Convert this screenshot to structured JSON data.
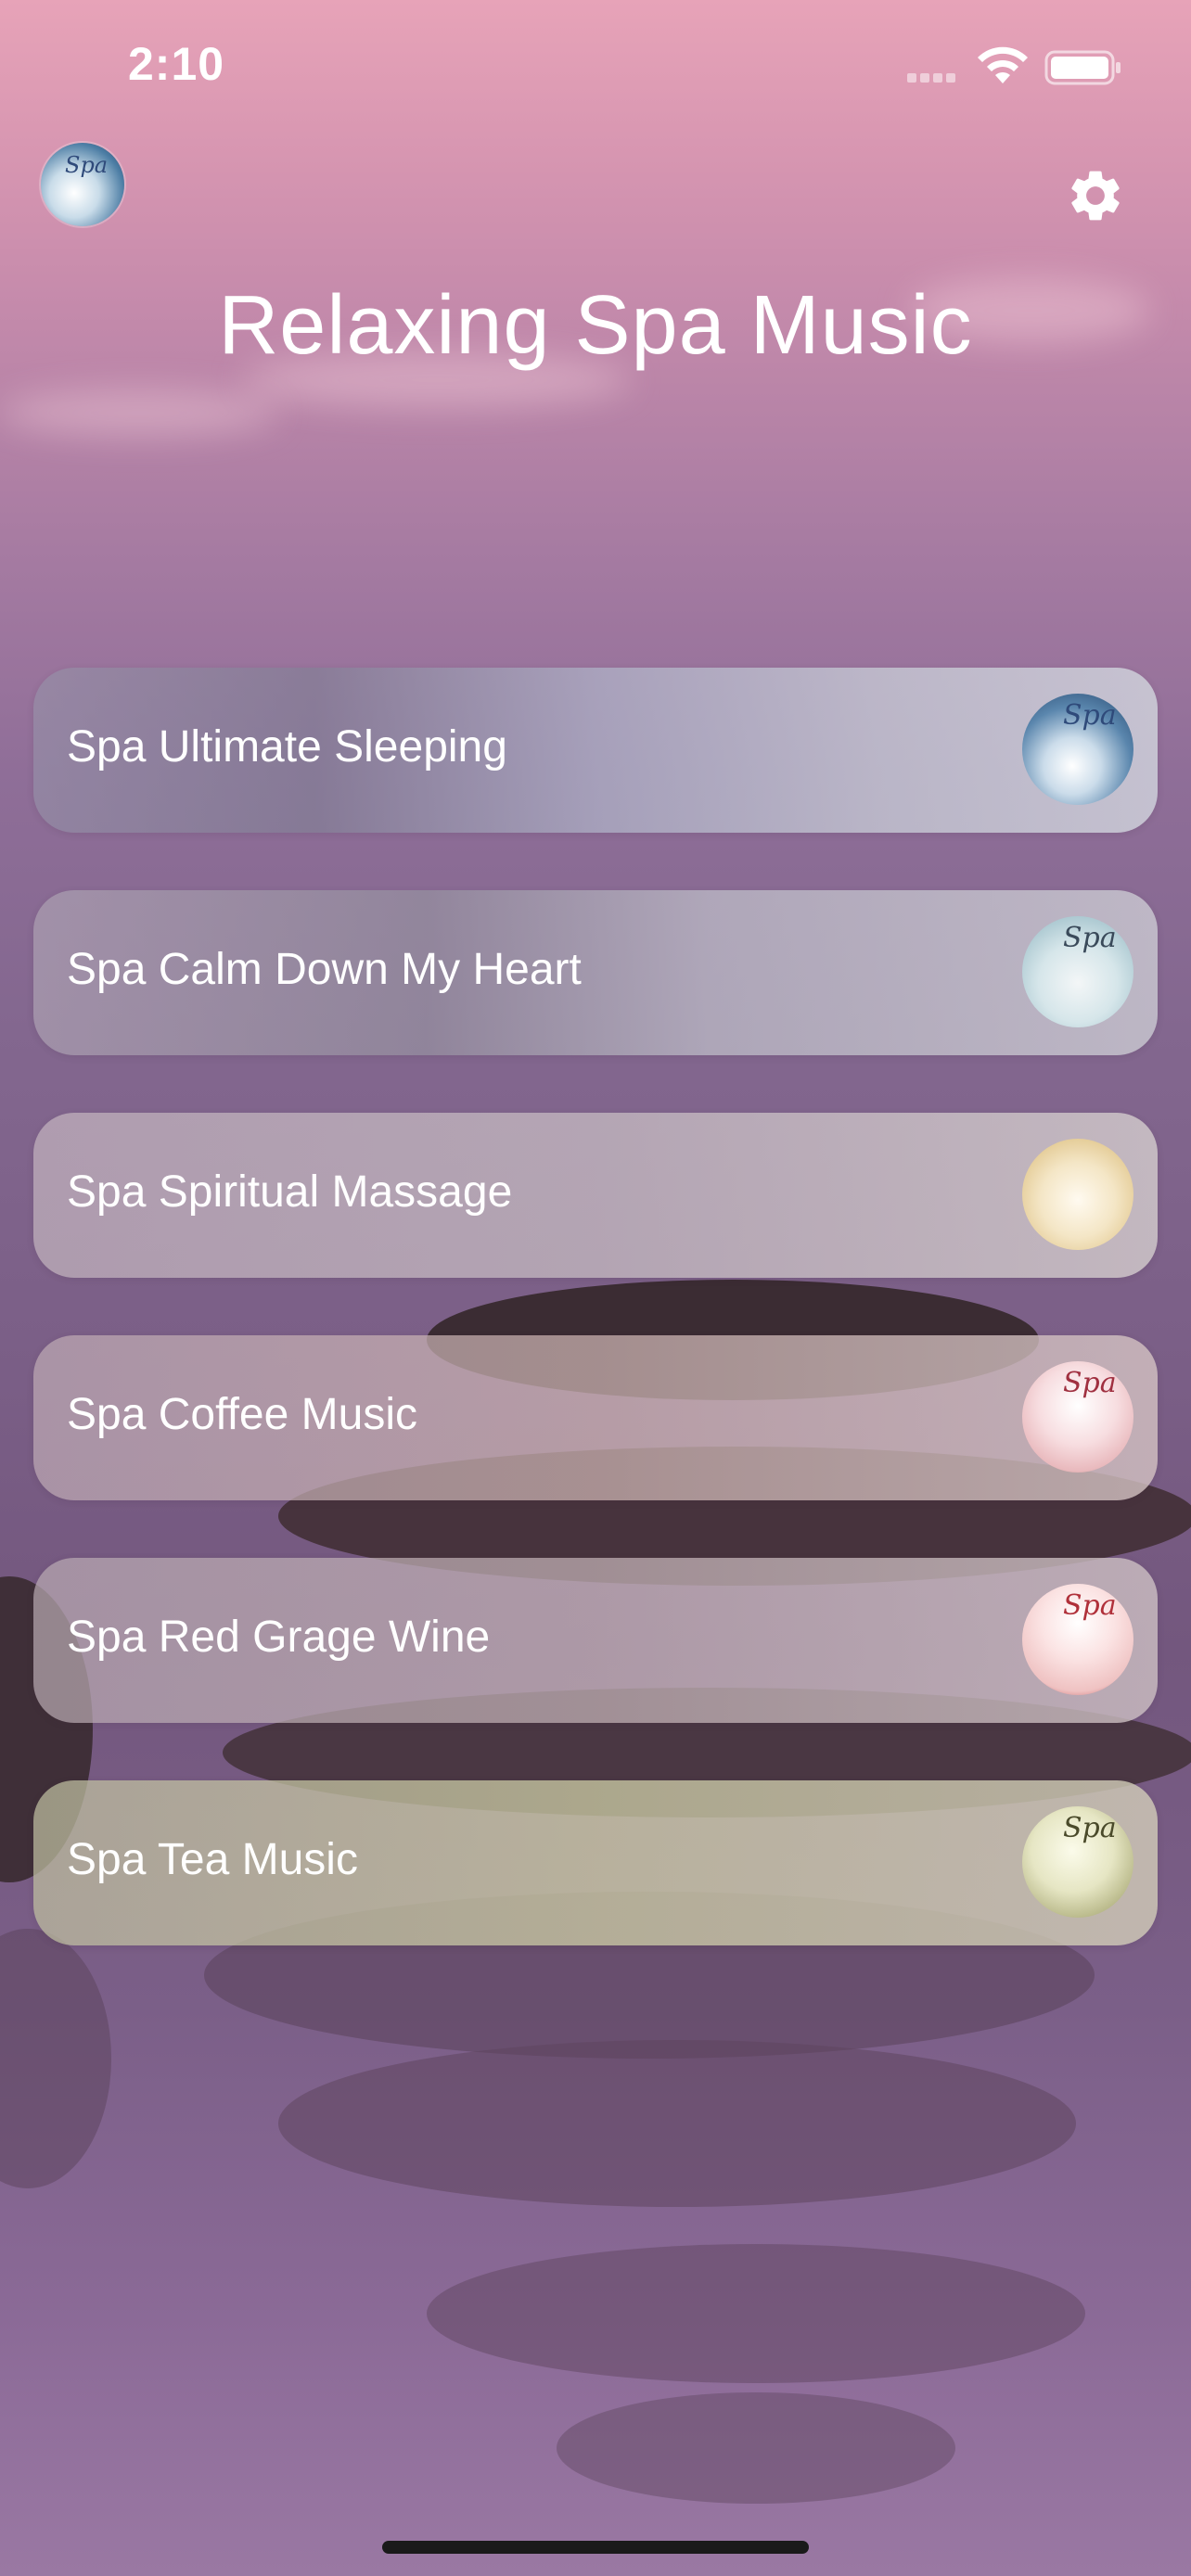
{
  "status_bar": {
    "time": "2:10"
  },
  "header": {
    "title": "Relaxing Spa Music",
    "avatar_label": "Spa",
    "settings_icon": "gear-icon"
  },
  "tracks": [
    {
      "title": "Spa Ultimate Sleeping",
      "thumb_label": "Spa"
    },
    {
      "title": "Spa Calm Down My Heart",
      "thumb_label": "Spa"
    },
    {
      "title": "Spa Spiritual Massage",
      "thumb_label": ""
    },
    {
      "title": "Spa Coffee Music",
      "thumb_label": "Spa"
    },
    {
      "title": "Spa Red Grage Wine",
      "thumb_label": "Spa"
    },
    {
      "title": "Spa Tea Music",
      "thumb_label": "Spa"
    }
  ],
  "colors": {
    "text": "#ffffff",
    "background_top": "#e7a3b8",
    "background_bottom": "#7b5f88"
  }
}
